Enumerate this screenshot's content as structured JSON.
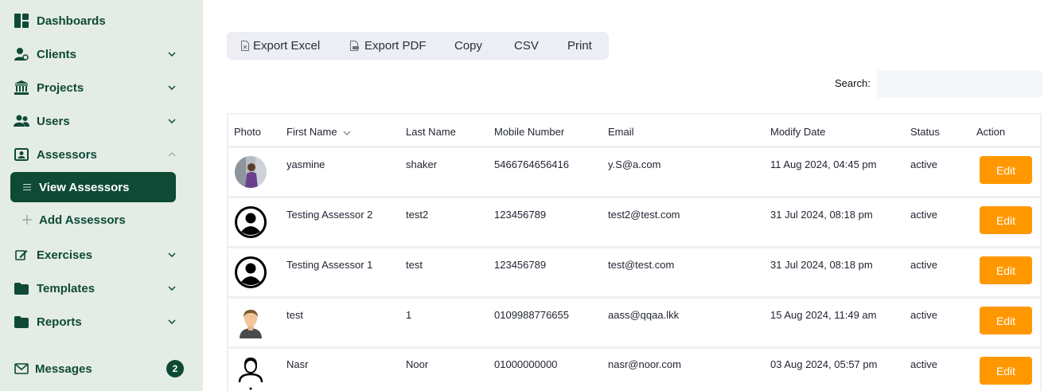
{
  "sidebar": {
    "items": [
      {
        "label": "Dashboards",
        "icon": "dashboard-icon"
      },
      {
        "label": "Clients",
        "icon": "client-icon"
      },
      {
        "label": "Projects",
        "icon": "bank-icon"
      },
      {
        "label": "Users",
        "icon": "users-icon"
      },
      {
        "label": "Assessors",
        "icon": "id-card-icon"
      },
      {
        "label": "Exercises",
        "icon": "edit-icon"
      },
      {
        "label": "Templates",
        "icon": "folder-icon"
      },
      {
        "label": "Reports",
        "icon": "folder-icon"
      },
      {
        "label": "Messages",
        "icon": "envelope-icon",
        "badge": "2"
      }
    ],
    "assessors_sub": [
      {
        "label": "View Assessors",
        "active": true
      },
      {
        "label": "Add Assessors",
        "active": false
      }
    ]
  },
  "toolbar": {
    "export_excel": "Export Excel",
    "export_pdf": "Export PDF",
    "copy": "Copy",
    "csv": "CSV",
    "print": "Print"
  },
  "search": {
    "label": "Search:",
    "value": ""
  },
  "table": {
    "headers": [
      "Photo",
      "First Name",
      "Last Name",
      "Mobile Number",
      "Email",
      "Modify Date",
      "Status",
      "Action"
    ],
    "rows": [
      {
        "first": "yasmine",
        "last": "shaker",
        "mobile": "5466764656416",
        "email": "y.S@a.com",
        "date": "11 Aug 2024, 04:45 pm",
        "status": "active",
        "action": "Edit",
        "photo": "photo-avatar"
      },
      {
        "first": "Testing Assessor 2",
        "last": "test2",
        "mobile": "123456789",
        "email": "test2@test.com",
        "date": "31 Jul 2024, 08:18 pm",
        "status": "active",
        "action": "Edit",
        "photo": "user-circle-icon"
      },
      {
        "first": "Testing Assessor 1",
        "last": "test",
        "mobile": "123456789",
        "email": "test@test.com",
        "date": "31 Jul 2024, 08:18 pm",
        "status": "active",
        "action": "Edit",
        "photo": "user-circle-icon"
      },
      {
        "first": "test",
        "last": "1",
        "mobile": "0109988776655",
        "email": "aass@qqaa.lkk",
        "date": "15 Aug 2024, 11:49 am",
        "status": "active",
        "action": "Edit",
        "photo": "default-person-avatar"
      },
      {
        "first": "Nasr",
        "last": "Noor",
        "mobile": "01000000000",
        "email": "nasr@noor.com",
        "date": "03 Aug 2024, 05:57 pm",
        "status": "active",
        "action": "Edit",
        "photo": "person-outline-icon"
      }
    ]
  }
}
